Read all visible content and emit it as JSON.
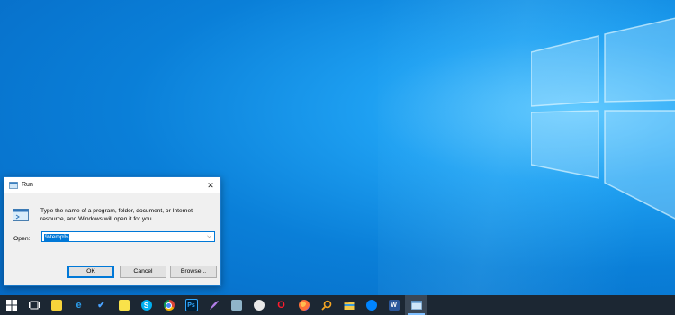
{
  "dialog": {
    "title": "Run",
    "close_glyph": "✕",
    "description": "Type the name of a program, folder, document, or Internet resource, and Windows will open it for you.",
    "open_label": "Open:",
    "open_value": "%temp%",
    "dropdown_glyph": "⌵",
    "ok_label": "OK",
    "cancel_label": "Cancel",
    "browse_label": "Browse..."
  },
  "taskbar": {
    "items": [
      {
        "name": "start-icon"
      },
      {
        "name": "task-view-icon"
      },
      {
        "name": "sticky-notes-icon"
      },
      {
        "name": "edge-icon",
        "glyph": "e"
      },
      {
        "name": "todo-icon",
        "glyph": "✔"
      },
      {
        "name": "notes-icon"
      },
      {
        "name": "skype-icon",
        "glyph": "S"
      },
      {
        "name": "chrome-icon"
      },
      {
        "name": "photoshop-icon",
        "glyph": "Ps"
      },
      {
        "name": "pen-app-icon"
      },
      {
        "name": "clipboard-app-icon"
      },
      {
        "name": "paint-app-icon"
      },
      {
        "name": "opera-icon",
        "glyph": "O"
      },
      {
        "name": "firefox-icon"
      },
      {
        "name": "search-app-icon"
      },
      {
        "name": "file-explorer-icon"
      },
      {
        "name": "messenger-icon"
      },
      {
        "name": "word-icon",
        "glyph": "W"
      },
      {
        "name": "run-taskbar-icon"
      }
    ]
  },
  "colors": {
    "accent": "#0078d7",
    "desktop": "#0a7fd8",
    "taskbar": "#1c2733"
  }
}
